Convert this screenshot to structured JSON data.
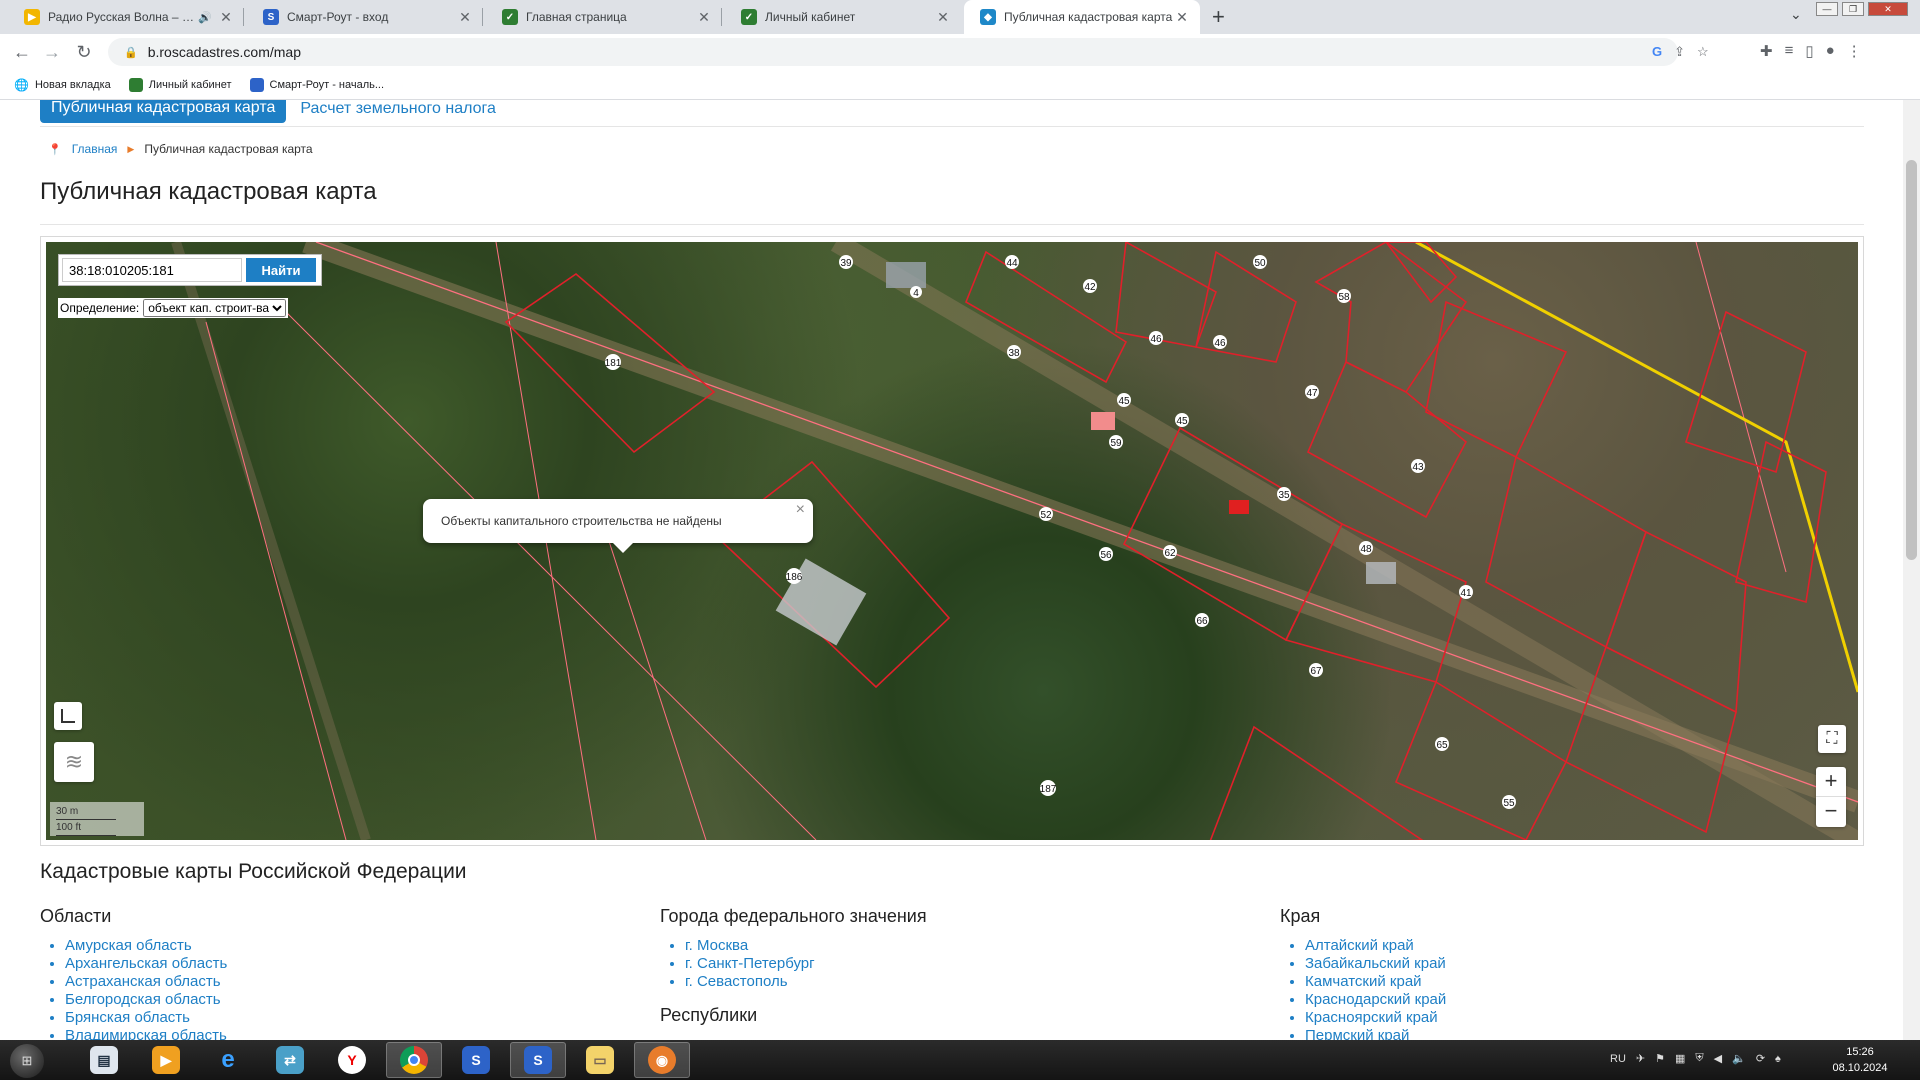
{
  "browser": {
    "tabs": [
      {
        "title": "Радио Русская Волна – слуша",
        "favicon": "play-icon",
        "color": "#f2b600"
      },
      {
        "title": "Смарт-Роут - вход",
        "favicon": "smart-route-icon",
        "color": "#2d63c8"
      },
      {
        "title": "Главная страница",
        "favicon": "gosuslugi-icon",
        "color": "#2e7d32"
      },
      {
        "title": "Личный кабинет",
        "favicon": "gosuslugi-icon",
        "color": "#2e7d32"
      },
      {
        "title": "Публичная кадастровая карта",
        "favicon": "roscadastres-icon",
        "color": "#1e88c8"
      }
    ],
    "url": "b.roscadastres.com/map",
    "bookmarks": [
      {
        "label": "Новая вкладка"
      },
      {
        "label": "Личный кабинет"
      },
      {
        "label": "Смарт-Роут - началь..."
      }
    ]
  },
  "site": {
    "nav": {
      "active": "Публичная кадастровая карта",
      "link": "Расчет земельного налога"
    },
    "breadcrumb": {
      "home": "Главная",
      "current": "Публичная кадастровая карта"
    },
    "title": "Публичная кадастровая карта"
  },
  "map": {
    "search_value": "38:18:010205:181",
    "search_button": "Найти",
    "definition_label": "Определение:",
    "definition_value": "объект кап. строит-ва",
    "popup_text": "Объекты капитального строительства не найдены",
    "scale": {
      "metric": "30 m",
      "imperial": "100 ft"
    },
    "zoom_in": "+",
    "zoom_out": "−",
    "parcel_labels": [
      "39",
      "4",
      "44",
      "42",
      "50",
      "58",
      "181",
      "38",
      "46",
      "46",
      "45",
      "45",
      "59",
      "47",
      "43",
      "35",
      "52",
      "56",
      "62",
      "48",
      "186",
      "41",
      "66",
      "67",
      "65",
      "187",
      "55"
    ]
  },
  "regions": {
    "title": "Кадастровые карты Российской Федерации",
    "oblasti": {
      "heading": "Области",
      "items": [
        "Амурская область",
        "Архангельская область",
        "Астраханская область",
        "Белгородская область",
        "Брянская область",
        "Владимирская область"
      ]
    },
    "cities": {
      "heading": "Города федерального значения",
      "items": [
        "г. Москва",
        "г. Санкт-Петербург",
        "г. Севастополь"
      ],
      "next_heading": "Республики"
    },
    "krai": {
      "heading": "Края",
      "items": [
        "Алтайский край",
        "Забайкальский край",
        "Камчатский край",
        "Краснодарский край",
        "Красноярский край",
        "Пермский край"
      ]
    }
  },
  "taskbar": {
    "lang": "RU",
    "time": "15:26",
    "date": "08.10.2024"
  },
  "colors": {
    "accent": "#1e7fc5",
    "parcel_border": "#e0202a",
    "boundary": "#f0d000"
  }
}
